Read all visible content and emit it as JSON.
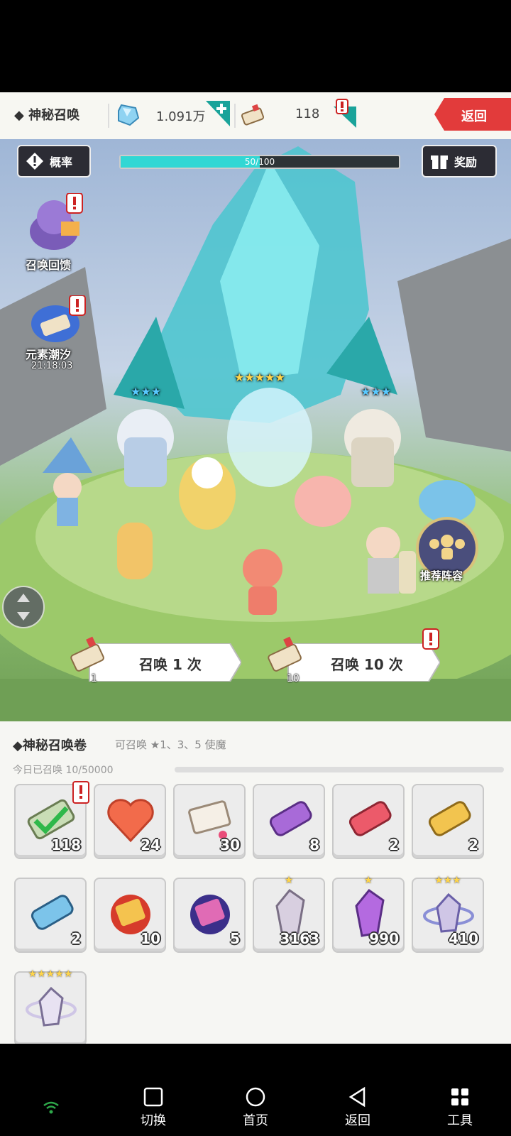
{
  "header": {
    "title": "◆ 神秘召唤",
    "gems": "1.091万",
    "scrolls": "118",
    "back": "返回"
  },
  "scene": {
    "odds_label": "概率",
    "reward_label": "奖励",
    "progress_text": "50/100",
    "progress_fraction": 0.5,
    "summon_feedback": "召唤回馈",
    "element_tide": "元素潮汐",
    "timer": "21:18:03",
    "recommend": "推荐阵容",
    "summon_one": "召唤 1 次",
    "summon_ten": "召唤 10 次",
    "summon_one_cost": "1",
    "summon_ten_cost": "10",
    "stars_left": "★★★",
    "stars_center": "★★★★★",
    "stars_right": "★★★"
  },
  "panel": {
    "title": "◆神秘召唤卷",
    "subtitle": "可召唤 ★1、3、5 使魔",
    "today": "今日已召唤 10/50000",
    "items": [
      {
        "count": "118",
        "icon": "scroll-check-icon"
      },
      {
        "count": "24",
        "icon": "heart-icon"
      },
      {
        "count": "30",
        "icon": "paper-scroll-icon"
      },
      {
        "count": "8",
        "icon": "purple-scroll-icon"
      },
      {
        "count": "2",
        "icon": "red-scroll-icon"
      },
      {
        "count": "2",
        "icon": "gold-scroll-icon"
      },
      {
        "count": "2",
        "icon": "blue-scroll-icon"
      },
      {
        "count": "10",
        "icon": "red-orb-scroll-icon"
      },
      {
        "count": "5",
        "icon": "purple-orb-scroll-icon"
      },
      {
        "count": "3163",
        "icon": "gray-crystal-icon",
        "stars": "★"
      },
      {
        "count": "990",
        "icon": "purple-crystal-icon",
        "stars": "★"
      },
      {
        "count": "410",
        "icon": "ring-crystal-icon",
        "stars": "★★★"
      },
      {
        "count": "",
        "icon": "ring-crystal-5-icon",
        "stars": "★★★★★"
      }
    ]
  },
  "nav": {
    "switch": "切换",
    "home": "首页",
    "back": "返回",
    "tools": "工具"
  }
}
